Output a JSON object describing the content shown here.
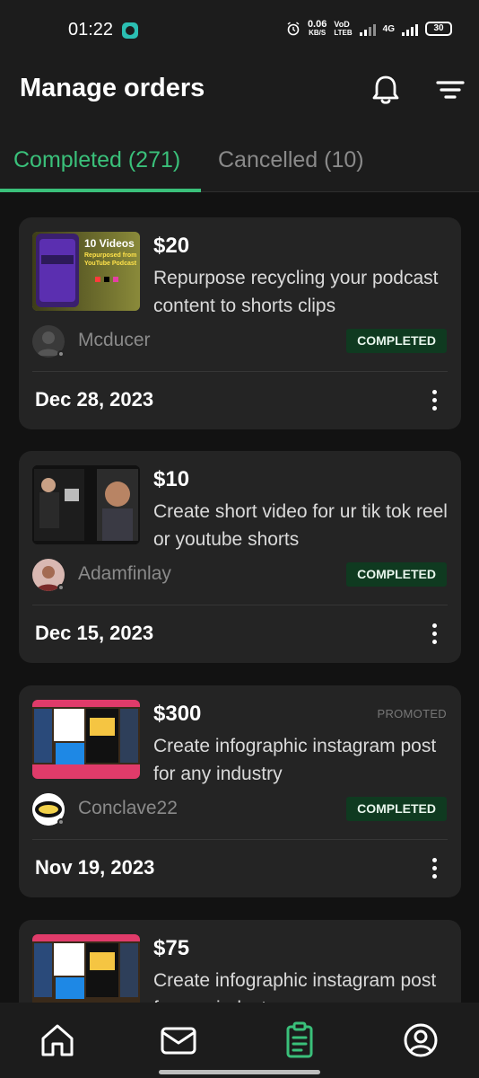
{
  "status_bar": {
    "time": "01:22",
    "speed_value": "0.06",
    "speed_unit": "KB/S",
    "volte_top": "VoD",
    "volte_bottom": "LTEB",
    "network": "4G",
    "battery": "30"
  },
  "header": {
    "title": "Manage orders",
    "icons": [
      "bell-icon",
      "filter-icon"
    ]
  },
  "tabs": [
    {
      "label": "Completed (271)",
      "active": true
    },
    {
      "label": "Cancelled (10)",
      "active": false
    }
  ],
  "orders": [
    {
      "price": "$20",
      "title": "Repurpose recycling your podcast content to shorts clips",
      "seller": "Mcducer",
      "status": "COMPLETED",
      "promoted": "",
      "date": "Dec 28, 2023",
      "thumb_headline": "10 Videos",
      "thumb_subline": "Repurposed from YouTube Podcast"
    },
    {
      "price": "$10",
      "title": "Create short video for ur tik tok reel or youtube shorts",
      "seller": "Adamfinlay",
      "status": "COMPLETED",
      "promoted": "",
      "date": "Dec 15, 2023"
    },
    {
      "price": "$300",
      "title": "Create infographic instagram post for any industry",
      "seller": "Conclave22",
      "status": "COMPLETED",
      "promoted": "PROMOTED",
      "date": "Nov 19, 2023"
    },
    {
      "price": "$75",
      "title": "Create infographic instagram post for any industry",
      "seller": "",
      "status": "",
      "promoted": "",
      "date": ""
    }
  ],
  "bottom_nav": [
    {
      "name": "home-icon",
      "active": false
    },
    {
      "name": "mail-icon",
      "active": false
    },
    {
      "name": "orders-clipboard-icon",
      "active": true
    },
    {
      "name": "profile-icon",
      "active": false
    }
  ],
  "colors": {
    "accent": "#3ac07a",
    "badge_bg": "#0f3a20",
    "card_bg": "#242424",
    "page_bg": "#121212"
  }
}
